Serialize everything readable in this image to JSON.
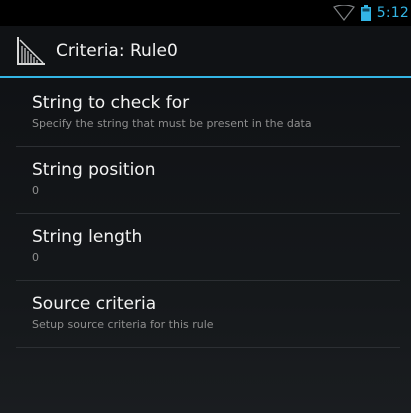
{
  "status_bar": {
    "time": "5:12",
    "wifi_icon": "wifi-icon",
    "battery_icon": "battery-icon",
    "accent_color": "#33b5e5"
  },
  "action_bar": {
    "title": "Criteria: Rule0",
    "app_icon": "app-icon"
  },
  "preferences": [
    {
      "title": "String to check for",
      "summary": "Specify the string that must be present in the data"
    },
    {
      "title": "String position",
      "summary": "0"
    },
    {
      "title": "String length",
      "summary": "0"
    },
    {
      "title": "Source criteria",
      "summary": "Setup source criteria for this rule"
    }
  ]
}
